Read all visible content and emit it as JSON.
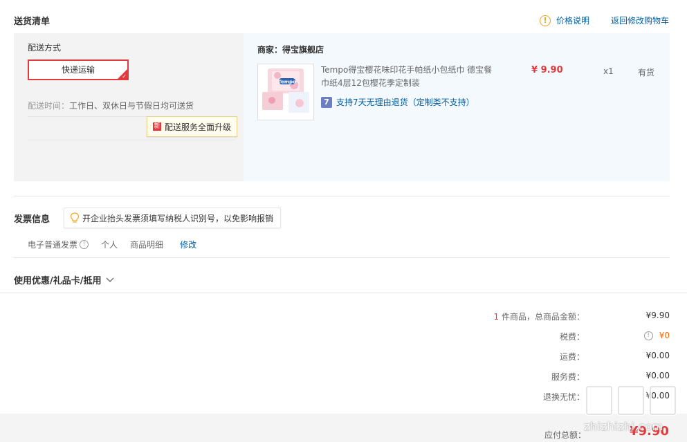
{
  "header": {
    "title": "送货清单",
    "price_note": "价格说明",
    "back_to_cart": "返回修改购物车"
  },
  "delivery": {
    "label": "配送方式",
    "option": "快递运输",
    "time_label": "配送时间：",
    "time_value": "工作日、双休日与节假日均可送货",
    "upgrade_badge": "新",
    "upgrade_text": "配送服务全面升级"
  },
  "item": {
    "merchant_label": "商家：",
    "merchant_name": "得宝旗舰店",
    "name": "Tempo得宝樱花味印花手帕纸小包纸巾 德宝餐巾纸4层12包樱花季定制装",
    "return_icon": "7",
    "return_policy": "支持7天无理由退货（定制类不支持）",
    "price": "¥ 9.90",
    "qty": "x1",
    "stock": "有货",
    "thumb_brand": "Tempo"
  },
  "invoice": {
    "title": "发票信息",
    "tip": "开企业抬头发票须填写纳税人识别号，以免影响报销",
    "type": "电子普通发票",
    "holder": "个人",
    "content": "商品明细",
    "edit": "修改"
  },
  "coupon": {
    "title": "使用优惠/礼品卡/抵用"
  },
  "summary": {
    "count": "1",
    "count_suffix": " 件商品，总商品金额：",
    "goods_total": "¥9.90",
    "tax_label": "税费：",
    "tax_value": "¥0",
    "freight_label": "运费：",
    "freight_value": "¥0.00",
    "service_label": "服务费：",
    "service_value": "¥0.00",
    "return_worry_label": "退换无忧：",
    "return_worry_value": "¥0.00",
    "payable_label": "应付总额：",
    "payable_value": "¥9.90"
  },
  "watermark": {
    "text": "zhizhizhi.com"
  },
  "colors": {
    "accent_red": "#e4393c",
    "link_blue": "#005ea7",
    "tax_orange": "#ff6600"
  }
}
